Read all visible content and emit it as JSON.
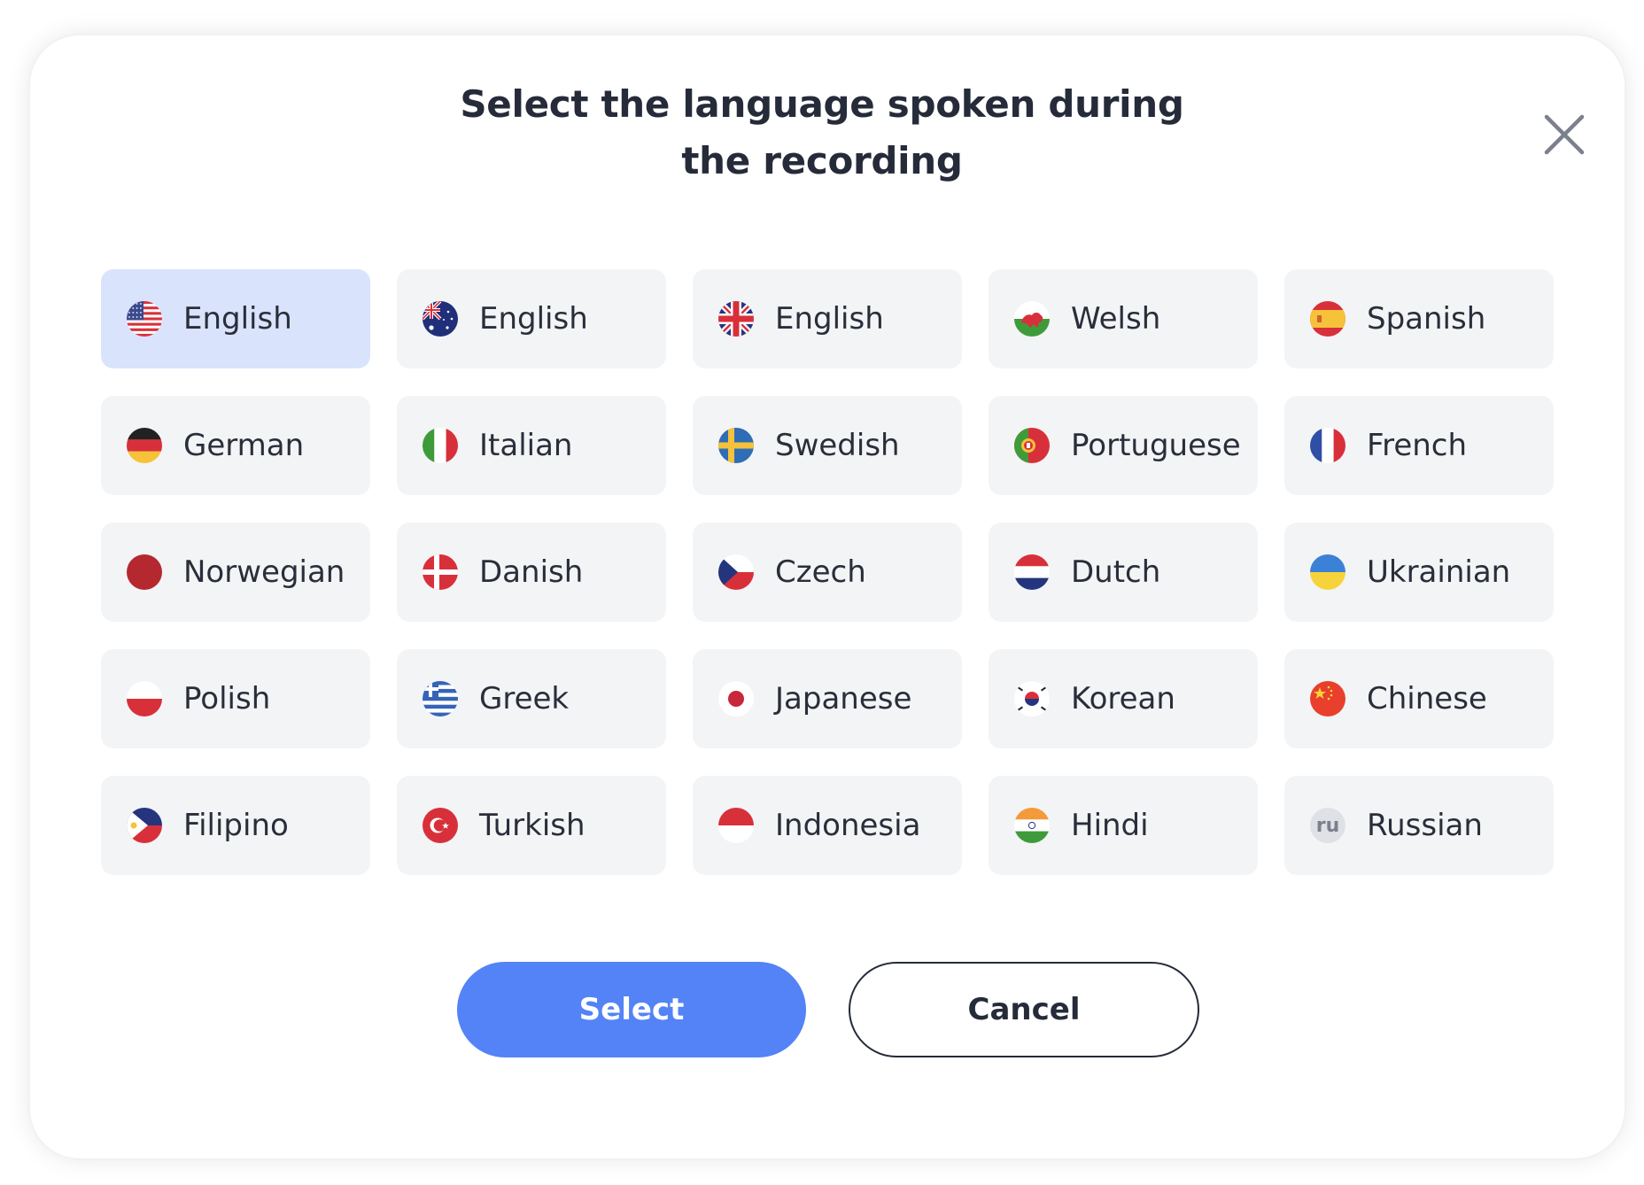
{
  "dialog": {
    "title": "Select the language spoken during\nthe recording",
    "close_icon": "close-icon"
  },
  "languages": [
    {
      "label": "English",
      "flag": "us-flag-icon",
      "selected": true
    },
    {
      "label": "English",
      "flag": "au-flag-icon",
      "selected": false
    },
    {
      "label": "English",
      "flag": "gb-flag-icon",
      "selected": false
    },
    {
      "label": "Welsh",
      "flag": "wales-flag-icon",
      "selected": false
    },
    {
      "label": "Spanish",
      "flag": "es-flag-icon",
      "selected": false
    },
    {
      "label": "German",
      "flag": "de-flag-icon",
      "selected": false
    },
    {
      "label": "Italian",
      "flag": "it-flag-icon",
      "selected": false
    },
    {
      "label": "Swedish",
      "flag": "se-flag-icon",
      "selected": false
    },
    {
      "label": "Portuguese",
      "flag": "pt-flag-icon",
      "selected": false
    },
    {
      "label": "French",
      "flag": "fr-flag-icon",
      "selected": false
    },
    {
      "label": "Norwegian",
      "flag": "no-flag-icon",
      "selected": false
    },
    {
      "label": "Danish",
      "flag": "dk-flag-icon",
      "selected": false
    },
    {
      "label": "Czech",
      "flag": "cz-flag-icon",
      "selected": false
    },
    {
      "label": "Dutch",
      "flag": "nl-flag-icon",
      "selected": false
    },
    {
      "label": "Ukrainian",
      "flag": "ua-flag-icon",
      "selected": false
    },
    {
      "label": "Polish",
      "flag": "pl-flag-icon",
      "selected": false
    },
    {
      "label": "Greek",
      "flag": "gr-flag-icon",
      "selected": false
    },
    {
      "label": "Japanese",
      "flag": "jp-flag-icon",
      "selected": false
    },
    {
      "label": "Korean",
      "flag": "kr-flag-icon",
      "selected": false
    },
    {
      "label": "Chinese",
      "flag": "cn-flag-icon",
      "selected": false
    },
    {
      "label": "Filipino",
      "flag": "ph-flag-icon",
      "selected": false
    },
    {
      "label": "Turkish",
      "flag": "tr-flag-icon",
      "selected": false
    },
    {
      "label": "Indonesia",
      "flag": "id-flag-icon",
      "selected": false
    },
    {
      "label": "Hindi",
      "flag": "in-flag-icon",
      "selected": false
    },
    {
      "label": "Russian",
      "flag": "ru-badge-icon",
      "badge_text": "ru",
      "selected": false
    }
  ],
  "actions": {
    "select_label": "Select",
    "cancel_label": "Cancel"
  },
  "colors": {
    "accent": "#5383f6",
    "selected_tile": "#d9e3fc",
    "tile": "#f3f4f6",
    "text": "#262b3a"
  }
}
